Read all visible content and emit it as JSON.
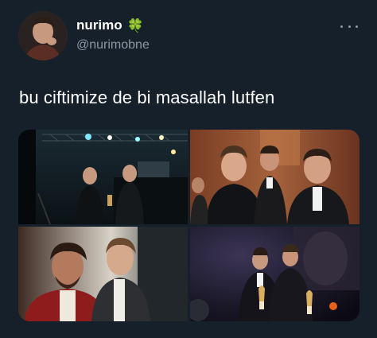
{
  "author": {
    "display_name": "nurimo",
    "name_emoji": "🍀",
    "handle": "@nurimobne"
  },
  "tweet": {
    "text": "bu ciftimize de bi masallah lutfen"
  },
  "icons": {
    "more": "more-horizontal-icon",
    "avatar": "profile-avatar"
  },
  "colors": {
    "background": "#15202b",
    "text_primary": "#ffffff",
    "text_secondary": "#8b98a5",
    "emoji_green": "#2e9e3a"
  }
}
